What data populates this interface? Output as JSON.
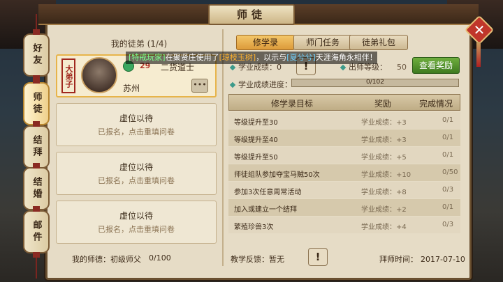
{
  "window": {
    "title": "师徒",
    "close_label": "✕"
  },
  "side_tabs": [
    {
      "label": "好友",
      "active": false
    },
    {
      "label": "师徒",
      "active": true
    },
    {
      "label": "结拜",
      "active": false
    },
    {
      "label": "结婚",
      "active": false
    },
    {
      "label": "邮件",
      "active": false
    }
  ],
  "left": {
    "section_title": "我的徒弟 (1/4)",
    "disciple": {
      "stamp": "大弟子",
      "level": "29",
      "name": "二货道士",
      "city": "苏州",
      "more": "•••"
    },
    "vacant_slots": [
      {
        "title": "虚位以待",
        "subtitle": "已报名，点击重填问卷"
      },
      {
        "title": "虚位以待",
        "subtitle": "已报名，点击重填问卷"
      },
      {
        "title": "虚位以待",
        "subtitle": "已报名，点击重填问卷"
      }
    ],
    "footer": {
      "label": "我的师德：初级师父",
      "value": "0/100"
    }
  },
  "tabs": [
    {
      "label": "修学录",
      "active": true
    },
    {
      "label": "师门任务",
      "active": false
    },
    {
      "label": "徒弟礼包",
      "active": false
    }
  ],
  "broadcast": {
    "p1": "[特戒玩家]",
    "p2": "在聚贤庄使用了",
    "p3": "[琼枝玉树]",
    "p4": "，以示与",
    "p5": "[夏兮兮]",
    "p6": "天涯海角永相伴！"
  },
  "stats": {
    "score_label": "学业成绩：0",
    "graduate_label": "出师等级：",
    "graduate_value": "50",
    "progress_label": "学业成绩进度：",
    "progress_text": "0/102",
    "progress_fraction": 0.0,
    "reward_button": "查看奖励",
    "warn": "!"
  },
  "table": {
    "headers": [
      "修学录目标",
      "奖励",
      "完成情况"
    ],
    "rows": [
      {
        "goal": "等级提升至30",
        "reward": "学业成绩：+3",
        "status": "0/1"
      },
      {
        "goal": "等级提升至40",
        "reward": "学业成绩：+3",
        "status": "0/1"
      },
      {
        "goal": "等级提升至50",
        "reward": "学业成绩：+5",
        "status": "0/1"
      },
      {
        "goal": "师徒组队参加夺宝马贼50次",
        "reward": "学业成绩：+10",
        "status": "0/50"
      },
      {
        "goal": "参加3次任意周常活动",
        "reward": "学业成绩：+8",
        "status": "0/3"
      },
      {
        "goal": "加入或建立一个结拜",
        "reward": "学业成绩：+2",
        "status": "0/1"
      },
      {
        "goal": "繁殖珍兽3次",
        "reward": "学业成绩：+4",
        "status": "0/3"
      }
    ]
  },
  "footer": {
    "feedback_label": "教学反馈：暂无",
    "date_label": "拜师时间：",
    "date_value": "2017-07-10"
  }
}
